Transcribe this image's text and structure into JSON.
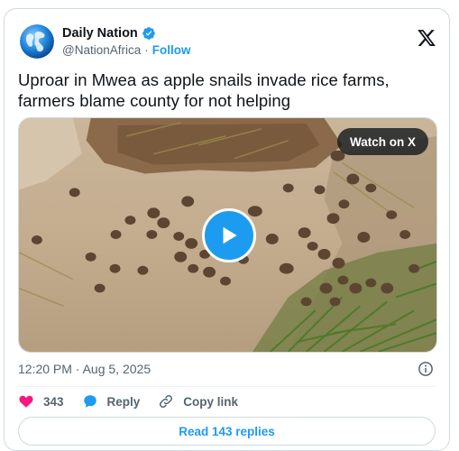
{
  "account": {
    "display_name": "Daily Nation",
    "handle": "@NationAfrica",
    "separator": "·",
    "follow_label": "Follow"
  },
  "tweet": {
    "text": "Uproar in Mwea as apple snails invade rice farms, farmers blame county for not helping",
    "timestamp": "12:20 PM · Aug 5, 2025"
  },
  "media": {
    "watch_label": "Watch on X"
  },
  "actions": {
    "likes": "343",
    "reply_label": "Reply",
    "copy_link_label": "Copy link"
  },
  "footer": {
    "read_replies_label": "Read 143 replies"
  },
  "colors": {
    "accent": "#1d9bf0",
    "like": "#f91880",
    "text_secondary": "#536471",
    "border": "#cfd9de"
  },
  "icons": [
    "globe-avatar-icon",
    "verified-badge-icon",
    "x-logo-icon",
    "play-icon",
    "info-icon",
    "heart-icon",
    "reply-bubble-icon",
    "link-icon"
  ]
}
